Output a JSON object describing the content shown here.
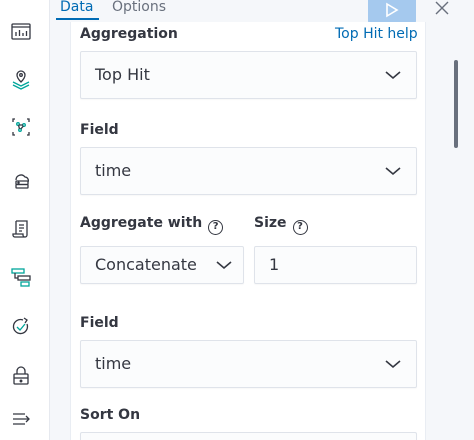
{
  "tabs": {
    "data": "Data",
    "options": "Options"
  },
  "sidebar_icons": [
    "dashboard-icon",
    "maps-icon",
    "ml-icon",
    "infrastructure-icon",
    "logs-icon",
    "apm-icon",
    "uptime-icon",
    "security-icon",
    "collapse-menu-icon"
  ],
  "aggregation": {
    "label": "Aggregation",
    "help_link": "Top Hit help",
    "selected": "Top Hit"
  },
  "field": {
    "label": "Field",
    "selected": "time"
  },
  "aggregate_with": {
    "label": "Aggregate with",
    "selected": "Concatenate"
  },
  "size": {
    "label": "Size",
    "value": "1"
  },
  "field2": {
    "label": "Field",
    "selected": "time"
  },
  "sort_on": {
    "label": "Sort On"
  },
  "colors": {
    "accent": "#006bb4",
    "play_button": "#a5c9ee",
    "text": "#343741"
  }
}
